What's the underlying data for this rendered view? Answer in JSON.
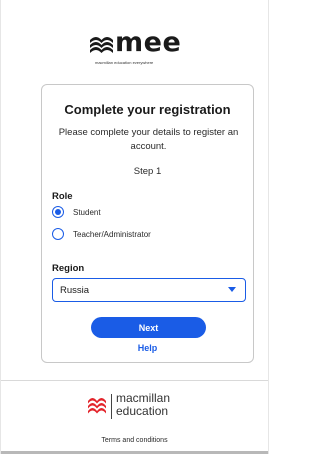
{
  "brand": {
    "mee_wordmark": "mee",
    "mee_tagline": "macmillan education everywhere",
    "macmillan_line1": "macmillan",
    "macmillan_line2": "education",
    "accent_color": "#1a5ce6",
    "macmillan_red": "#e3242b"
  },
  "registration": {
    "title": "Complete your registration",
    "description": "Please complete your details to register an account.",
    "step": "Step 1",
    "role": {
      "label": "Role",
      "options": [
        {
          "label": "Student",
          "selected": true
        },
        {
          "label": "Teacher/Administrator",
          "selected": false
        }
      ]
    },
    "region": {
      "label": "Region",
      "selected": "Russia"
    },
    "next_label": "Next",
    "help_label": "Help"
  },
  "footer": {
    "terms_label": "Terms and conditions"
  },
  "icons": {
    "mee_logo_mark": "mee-logo-mark-icon",
    "macmillan_logo_mark": "macmillan-logo-mark-icon",
    "dropdown_caret": "chevron-down-icon"
  }
}
